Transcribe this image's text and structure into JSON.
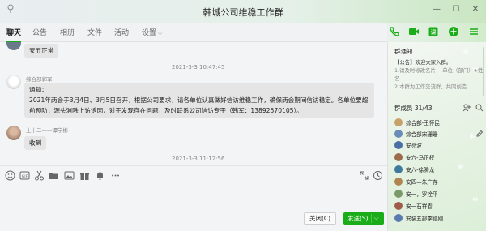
{
  "window": {
    "title": "韩城公司维稳工作群"
  },
  "tabs": [
    {
      "label": "聊天"
    },
    {
      "label": "公告"
    },
    {
      "label": "相册"
    },
    {
      "label": "文件"
    },
    {
      "label": "活动"
    },
    {
      "label": "设置"
    }
  ],
  "header_icons": [
    "phone-icon",
    "video-icon",
    "whiteboard-icon",
    "add-icon",
    "more-icon"
  ],
  "chat": {
    "messages": [
      {
        "text": "安五正常"
      },
      {
        "timestamp": "2021-3-3 10:47:45",
        "sender": "综合部郭军",
        "text": "通知：\n2021年两会于3月4日、3月5日召开，根据公司要求，请各单位认真做好信访维稳工作，确保两会期间信访稳定。各单位要超前预防，源头消除上访诱因，对于发现存在问题，及时联系公司信访专干（韩军：13892570105）。"
      },
      {
        "sender": "土十二——谭学彬",
        "text": "收到"
      },
      {
        "timestamp": "2021-3-3 11:12:56"
      }
    ]
  },
  "toolbar_icons": [
    "emoji-icon",
    "gif-icon",
    "scissors-icon",
    "folder-icon",
    "image-icon",
    "gift-icon",
    "bell-icon",
    "more-icon",
    "expand-icon",
    "history-icon"
  ],
  "buttons": {
    "close": "关闭(C)",
    "send": "发送(S)"
  },
  "right_panel": {
    "notice_title": "群通知",
    "notice_lines": [
      "【公告】欢迎大家入群。",
      "1.请及时修改名片，     单位（部门）+姓名",
      "2.本群为工作交流群，共同创造"
    ],
    "members_title": "群成员",
    "members_count": "31/43",
    "members": [
      {
        "name": "综合部-王怀民",
        "color": "#c8a06a"
      },
      {
        "name": "综合部宋珊珊",
        "color": "#6a8db8"
      },
      {
        "name": "安亮波",
        "color": "#4a6fa5"
      },
      {
        "name": "安六-马正权",
        "color": "#9b6b4a"
      },
      {
        "name": "安六-徐腾龙",
        "color": "#3d7a9c"
      },
      {
        "name": "安四—朱广存",
        "color": "#b0854f"
      },
      {
        "name": "安一，罗拴平",
        "color": "#7a9a6a"
      },
      {
        "name": "安一石祥春",
        "color": "#a05a4a"
      },
      {
        "name": "安装五部李德刚",
        "color": "#5a7ab0"
      }
    ]
  },
  "colors": {
    "accent": "#1aad19",
    "bubble": "#e5e5e5"
  }
}
